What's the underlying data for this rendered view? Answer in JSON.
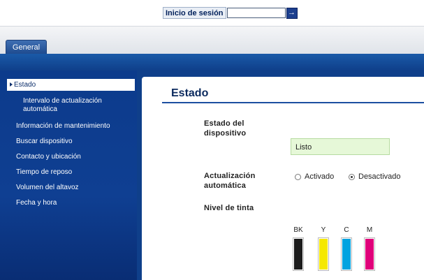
{
  "login": {
    "label": "Inicio de sesión",
    "input_value": "",
    "go_icon": "arrow-right-icon"
  },
  "tabs": [
    {
      "label": "General",
      "active": true
    }
  ],
  "sidebar": {
    "items": [
      {
        "label": "Estado",
        "active": true
      },
      {
        "label": "Intervalo de actualización automática",
        "sub": true
      },
      {
        "label": "Información de mantenimiento"
      },
      {
        "label": "Buscar dispositivo"
      },
      {
        "label": "Contacto y ubicación"
      },
      {
        "label": "Tiempo de reposo"
      },
      {
        "label": "Volumen del altavoz"
      },
      {
        "label": "Fecha y hora"
      }
    ]
  },
  "main": {
    "title": "Estado",
    "device_status_label": "Estado del dispositivo",
    "device_status_value": "Listo",
    "auto_update_label": "Actualización automática",
    "auto_update_options": [
      {
        "label": "Activado",
        "selected": false
      },
      {
        "label": "Desactivado",
        "selected": true
      }
    ],
    "ink_label": "Nivel de tinta",
    "inks": [
      {
        "name": "BK",
        "color": "#1c1c1c"
      },
      {
        "name": "Y",
        "color": "#f5e800"
      },
      {
        "name": "C",
        "color": "#00a3e0"
      },
      {
        "name": "M",
        "color": "#e0007a"
      }
    ]
  },
  "colors": {
    "accent": "#0f3f8a",
    "status_bg": "#e6f8d8"
  }
}
